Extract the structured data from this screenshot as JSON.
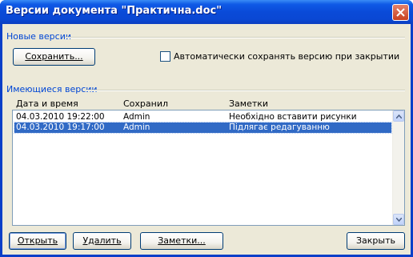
{
  "window": {
    "title": "Версии документа \"Практична.doc\""
  },
  "new_versions": {
    "group_label": "Новые версии",
    "save_label": "Сохранить...",
    "auto_save_label": "Автоматически сохранять версию при закрытии",
    "auto_save_checked": false
  },
  "existing_versions": {
    "group_label": "Имеющиеся версии",
    "columns": [
      "Дата и время",
      "Сохранил",
      "Заметки"
    ],
    "rows": [
      {
        "date": "04.03.2010 19:22:00",
        "saved_by": "Admin",
        "notes": "Необхідно вставити рисунки",
        "selected": false
      },
      {
        "date": "04.03.2010 19:17:00",
        "saved_by": "Admin",
        "notes": "Підлягає редагуванню",
        "selected": true
      }
    ]
  },
  "buttons": {
    "open": "Открыть",
    "delete": "Удалить",
    "notes": "Заметки...",
    "close": "Закрыть"
  },
  "icons": {
    "close": "close-x-icon",
    "checkbox": "checkbox-unchecked-icon",
    "scroll_up": "arrow-up-icon",
    "scroll_down": "arrow-down-icon"
  },
  "colors": {
    "titlebar": "#0a4ad8",
    "group_label": "#0046d5",
    "selection": "#316ac5",
    "dialog_bg": "#ece9d8"
  }
}
